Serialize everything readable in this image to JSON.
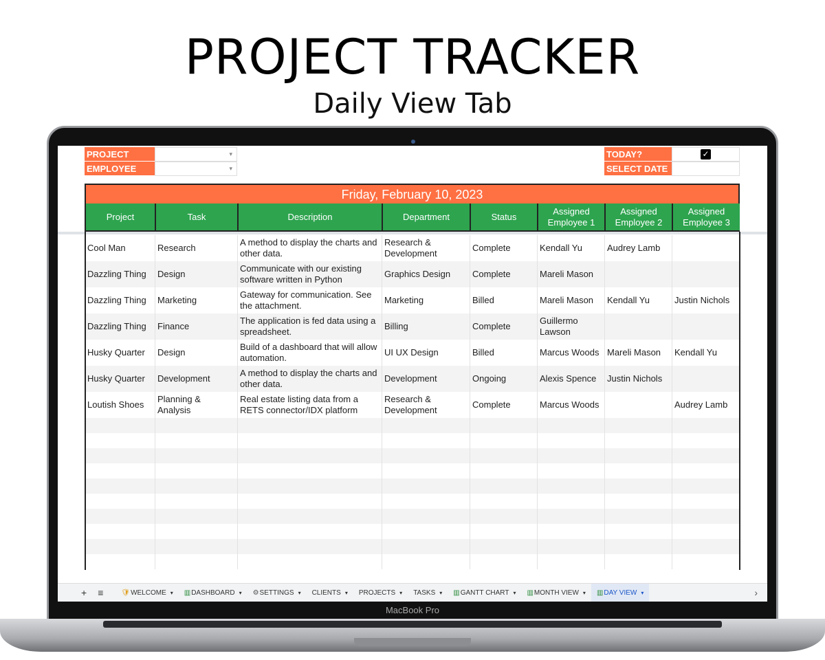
{
  "heading": {
    "title": "PROJECT TRACKER",
    "subtitle": "Daily View Tab"
  },
  "laptop_brand": "MacBook Pro",
  "filters": {
    "project_label": "PROJECT",
    "employee_label": "EMPLOYEE",
    "today_label": "TODAY?",
    "today_checked": true,
    "select_date_label": "SELECT DATE",
    "dropdown_arrow": "▾",
    "check": "✓"
  },
  "date_header": "Friday, February 10, 2023",
  "columns": [
    "Project",
    "Task",
    "Description",
    "Department",
    "Status",
    "Assigned Employee 1",
    "Assigned Employee 2",
    "Assigned Employee 3"
  ],
  "rows": [
    [
      "Cool Man",
      "Research",
      "A method to display the charts and other data.",
      "Research & Development",
      "Complete",
      "Kendall Yu",
      "Audrey Lamb",
      ""
    ],
    [
      "Dazzling Thing",
      "Design",
      "Communicate with our existing software written in Python",
      "Graphics Design",
      "Complete",
      "Mareli Mason",
      "",
      ""
    ],
    [
      "Dazzling Thing",
      "Marketing",
      "Gateway for communication. See the attachment.",
      "Marketing",
      "Billed",
      "Mareli Mason",
      "Kendall Yu",
      "Justin Nichols"
    ],
    [
      "Dazzling Thing",
      "Finance",
      "The application is fed data using a spreadsheet.",
      "Billing",
      "Complete",
      "Guillermo Lawson",
      "",
      ""
    ],
    [
      "Husky Quarter",
      "Design",
      "Build of a dashboard that will allow automation.",
      "UI UX Design",
      "Billed",
      "Marcus Woods",
      "Mareli Mason",
      "Kendall Yu"
    ],
    [
      "Husky Quarter",
      "Development",
      "A method to display the charts and other data.",
      "Development",
      "Ongoing",
      "Alexis Spence",
      "Justin Nichols",
      ""
    ],
    [
      "Loutish Shoes",
      "Planning & Analysis",
      "Real estate listing data from a RETS connector/IDX platform",
      "Research & Development",
      "Complete",
      "Marcus Woods",
      "",
      "Audrey Lamb"
    ]
  ],
  "sheet_tabs": {
    "add": "+",
    "menu": "≡",
    "items": [
      "WELCOME",
      "DASHBOARD",
      "SETTINGS",
      "CLIENTS",
      "PROJECTS",
      "TASKS",
      "GANTT CHART",
      "MONTH VIEW",
      "DAY VIEW"
    ],
    "active": "DAY VIEW",
    "caret": "▾",
    "next": "›"
  },
  "colors": {
    "orange": "#ff7043",
    "green": "#2ea44f"
  }
}
